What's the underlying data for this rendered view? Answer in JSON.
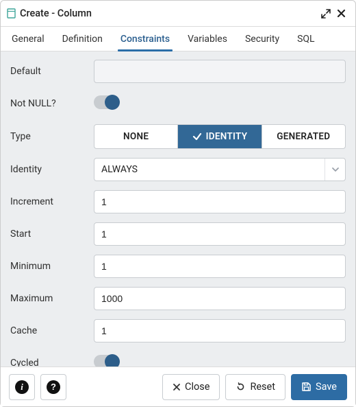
{
  "header": {
    "title": "Create - Column"
  },
  "tabs": [
    {
      "label": "General"
    },
    {
      "label": "Definition"
    },
    {
      "label": "Constraints",
      "active": true
    },
    {
      "label": "Variables"
    },
    {
      "label": "Security"
    },
    {
      "label": "SQL"
    }
  ],
  "form": {
    "default_label": "Default",
    "default_value": "",
    "notnull_label": "Not NULL?",
    "notnull_on": true,
    "type_label": "Type",
    "type_options": [
      {
        "label": "NONE"
      },
      {
        "label": "IDENTITY",
        "active": true
      },
      {
        "label": "GENERATED"
      }
    ],
    "identity_label": "Identity",
    "identity_value": "ALWAYS",
    "increment_label": "Increment",
    "increment_value": "1",
    "start_label": "Start",
    "start_value": "1",
    "minimum_label": "Minimum",
    "minimum_value": "1",
    "maximum_label": "Maximum",
    "maximum_value": "1000",
    "cache_label": "Cache",
    "cache_value": "1",
    "cycled_label": "Cycled",
    "cycled_on": true
  },
  "footer": {
    "close_label": "Close",
    "reset_label": "Reset",
    "save_label": "Save"
  },
  "colors": {
    "accent": "#2d6ca4"
  }
}
